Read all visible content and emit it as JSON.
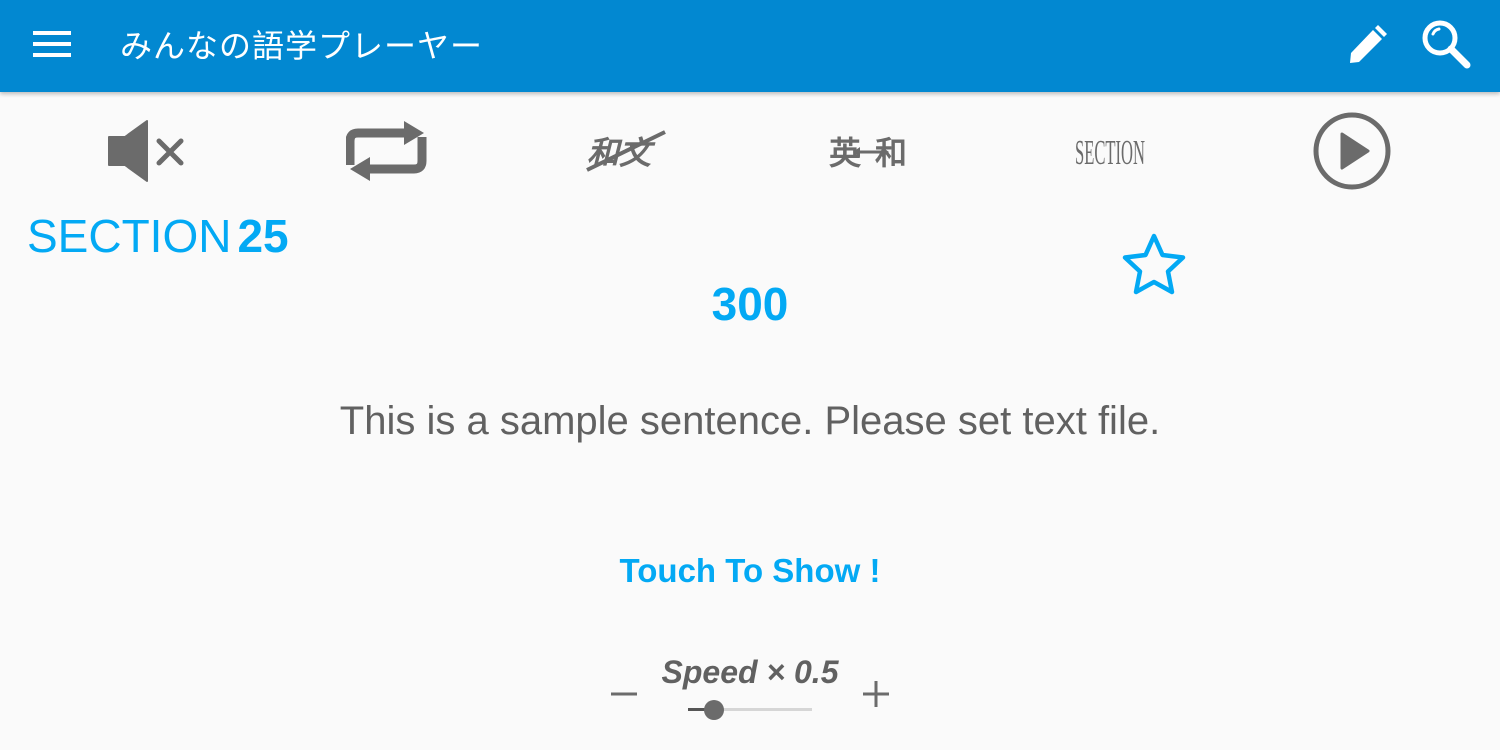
{
  "appbar": {
    "title": "みんなの語学プレーヤー",
    "menu_icon": "hamburger-menu-icon",
    "actions": [
      {
        "name": "edit",
        "icon": "pencil-icon"
      },
      {
        "name": "search",
        "icon": "magnifier-icon"
      }
    ]
  },
  "toolbar": {
    "items": [
      {
        "name": "mute",
        "icon": "volume-off-icon"
      },
      {
        "name": "repeat",
        "icon": "repeat-icon"
      },
      {
        "name": "japanese-english",
        "icon": "jp-en-crossed-icon",
        "glyph_text": "和文"
      },
      {
        "name": "english-japanese",
        "icon": "en-jp-swap-icon",
        "glyph_text": "英和"
      },
      {
        "name": "section",
        "icon": "section-text-icon",
        "glyph_text": "SECTION"
      },
      {
        "name": "play",
        "icon": "play-circle-icon"
      }
    ]
  },
  "section": {
    "label": "SECTION",
    "number": "25"
  },
  "count": "300",
  "favorite": {
    "icon": "star-outline-icon",
    "active": false
  },
  "sentence": "This is a sample sentence. Please set text file.",
  "touch_to_show": "Touch To Show !",
  "speed": {
    "label": "Speed × 0.5",
    "minus": "−",
    "plus": "+",
    "slider_fraction": 0.21
  },
  "colors": {
    "primary": "#0288d1",
    "accent": "#03a9f4",
    "icon_gray": "#6b6b6b",
    "text_gray": "#616161",
    "background": "#fafafa"
  }
}
